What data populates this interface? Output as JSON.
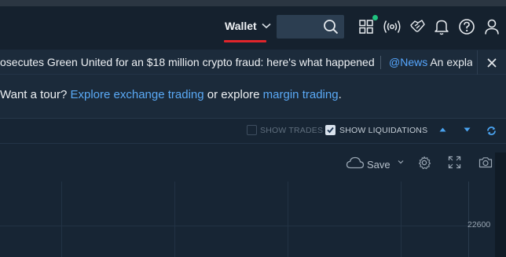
{
  "header": {
    "wallet_label": "Wallet",
    "search_placeholder": "",
    "icons": [
      "apps-grid-icon",
      "broadcast-icon",
      "handshake-icon",
      "bell-icon",
      "help-icon",
      "user-icon"
    ]
  },
  "ticker": {
    "headline": "osecutes Green United for an $18 million crypto fraud: here's what happened",
    "news_tag": "@News",
    "news_text": "An expla"
  },
  "tour": {
    "prefix": "Want a tour?",
    "link1": "Explore exchange trading",
    "middle": "or explore",
    "link2": "margin trading",
    "suffix": "."
  },
  "controls": {
    "show_trades_label": "SHOW TRADES",
    "show_trades_checked": false,
    "show_liquidations_label": "SHOW LIQUIDATIONS",
    "show_liquidations_checked": true
  },
  "toolbar": {
    "save_label": "Save"
  },
  "chart": {
    "price_label": "22600"
  },
  "colors": {
    "accent_blue": "#5aa9f5",
    "wallet_underline": "#e0252b",
    "notification_dot": "#1fc27f",
    "background": "#1b2a3a"
  }
}
